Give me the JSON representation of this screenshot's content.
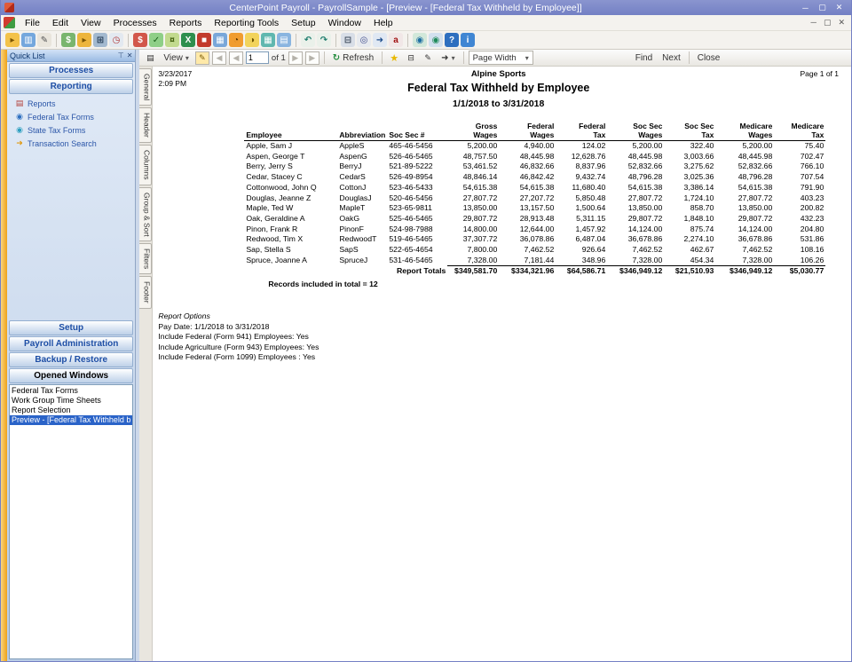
{
  "window": {
    "title": "CenterPoint Payroll - PayrollSample - [Preview - [Federal Tax Withheld by Employee]]",
    "controls": {
      "minimize": "─",
      "restore": "▢",
      "close": "✕"
    }
  },
  "menu": {
    "items": [
      "File",
      "Edit",
      "View",
      "Processes",
      "Reports",
      "Reporting Tools",
      "Setup",
      "Window",
      "Help"
    ]
  },
  "toolbar": {
    "icons": [
      {
        "name": "open-icon",
        "glyph": "▸",
        "bg": "#f3c24a",
        "color": "#7a5403"
      },
      {
        "name": "new-window-icon",
        "glyph": "▥",
        "bg": "#74a7dd",
        "color": "#ffffff"
      },
      {
        "name": "edit-icon",
        "glyph": "✎",
        "bg": "#e9e5dc",
        "color": "#555555"
      },
      {
        "sep": true
      },
      {
        "name": "money-icon",
        "glyph": "$",
        "bg": "#79b56e",
        "color": "#ffffff"
      },
      {
        "name": "folder-icon",
        "glyph": "▸",
        "bg": "#edb53c",
        "color": "#7a5403"
      },
      {
        "name": "calculator-icon",
        "glyph": "⊞",
        "bg": "#a3b9cf",
        "color": "#243b55"
      },
      {
        "name": "time-clock-icon",
        "glyph": "◷",
        "bg": "#e3e9f0",
        "color": "#b03434"
      },
      {
        "sep": true
      },
      {
        "name": "pay-employees-icon",
        "glyph": "$",
        "bg": "#d2574a",
        "color": "#ffffff"
      },
      {
        "name": "pay-checks-icon",
        "glyph": "✓",
        "bg": "#8fcf87",
        "color": "#175e17"
      },
      {
        "name": "cash-icon",
        "glyph": "¤",
        "bg": "#c2da8e",
        "color": "#42600f"
      },
      {
        "name": "excel-export-icon",
        "glyph": "X",
        "bg": "#2e8f4d",
        "color": "#ffffff"
      },
      {
        "name": "stop-icon",
        "glyph": "■",
        "bg": "#c23a2b",
        "color": "#ffffff"
      },
      {
        "name": "table-icon",
        "glyph": "▦",
        "bg": "#79a7d9",
        "color": "#ffffff"
      },
      {
        "name": "alarm-clock-icon",
        "glyph": "◔",
        "bg": "#f09c2f",
        "color": "#5d3800"
      },
      {
        "name": "timesheet-icon",
        "glyph": "◑",
        "bg": "#f2d35b",
        "color": "#6b5200"
      },
      {
        "name": "calendar-icon",
        "glyph": "▦",
        "bg": "#5fb7af",
        "color": "#ffffff"
      },
      {
        "name": "grid-icon",
        "glyph": "▤",
        "bg": "#8ab5e0",
        "color": "#ffffff"
      },
      {
        "sep": true
      },
      {
        "name": "undo-icon",
        "glyph": "↶",
        "bg": "#eaf1ea",
        "color": "#1e7c6d"
      },
      {
        "name": "redo-icon",
        "glyph": "↷",
        "bg": "#eaf1ea",
        "color": "#1e7c6d"
      },
      {
        "sep": true
      },
      {
        "name": "print-icon",
        "glyph": "⊟",
        "bg": "#d8dee7",
        "color": "#3d4a5c"
      },
      {
        "name": "print-preview-icon",
        "glyph": "◎",
        "bg": "#e7eaef",
        "color": "#3d4a8c"
      },
      {
        "name": "export-icon",
        "glyph": "➜",
        "bg": "#e0e8f3",
        "color": "#1f4e8c"
      },
      {
        "name": "pdf-icon",
        "glyph": "a",
        "bg": "#f1e7e7",
        "color": "#a01010"
      },
      {
        "sep": true
      },
      {
        "name": "globe-icon",
        "glyph": "◉",
        "bg": "#d2e8da",
        "color": "#1d6fa1"
      },
      {
        "name": "web-icon",
        "glyph": "◉",
        "bg": "#d2e0ee",
        "color": "#1e8a59"
      },
      {
        "name": "help-icon",
        "glyph": "?",
        "bg": "#2e6fbf",
        "color": "#ffffff"
      },
      {
        "name": "about-icon",
        "glyph": "i",
        "bg": "#4086d3",
        "color": "#ffffff"
      }
    ]
  },
  "quick_list": {
    "title": "Quick List",
    "header_icons": {
      "pin": "⊤",
      "close": "✕"
    },
    "processes_label": "Processes",
    "reporting_label": "Reporting",
    "reporting_items": [
      {
        "label": "Reports",
        "icon": "reports-icon",
        "glyph": "▤",
        "color": "#b2403a"
      },
      {
        "label": "Federal Tax Forms",
        "icon": "federal-tax-forms-icon",
        "glyph": "◉",
        "color": "#2d6fc0"
      },
      {
        "label": "State Tax Forms",
        "icon": "state-tax-forms-icon",
        "glyph": "◉",
        "color": "#2d9fc0"
      },
      {
        "label": "Transaction Search",
        "icon": "transaction-search-icon",
        "glyph": "➜",
        "color": "#e09a12"
      }
    ],
    "setup_label": "Setup",
    "payroll_admin_label": "Payroll Administration",
    "backup_label": "Backup / Restore",
    "opened_windows_label": "Opened Windows",
    "opened_windows": {
      "items": [
        "Federal Tax Forms",
        "Work Group Time Sheets",
        "Report Selection",
        "Preview - [Federal Tax Withheld b"
      ],
      "selected_index": 3
    }
  },
  "preview": {
    "toolbar": {
      "options_icon": "▤",
      "view_label": "View",
      "caret": "▾",
      "annotation_icon": "✎",
      "nav_first": "◀",
      "nav_prev": "◀",
      "page_value": "1",
      "pages_label": "of 1",
      "nav_next": "▶",
      "nav_last": "▶",
      "refresh_icon": "↻",
      "refresh_label": "Refresh",
      "favorite_icon": "★",
      "print_icon": "⊟",
      "page_setup_icon": "✎",
      "export_icon": "➜",
      "zoom_value": "Page Width",
      "find_label": "Find",
      "next_label": "Next",
      "close_label": "Close"
    },
    "side_tabs": [
      "General",
      "Header",
      "Columns",
      "Group & Sort",
      "Filters",
      "Footer"
    ]
  },
  "report": {
    "generated_date": "3/23/2017",
    "generated_time": "2:09 PM",
    "company": "Alpine Sports",
    "title": "Federal Tax Withheld by Employee",
    "date_range": "1/1/2018 to 3/31/2018",
    "page_label": "Page 1 of 1",
    "table": {
      "columns": [
        {
          "label": "Employee"
        },
        {
          "label": "Abbreviation"
        },
        {
          "label": "Soc Sec #"
        },
        {
          "label": "Gross\nWages"
        },
        {
          "label": "Federal\nWages"
        },
        {
          "label": "Federal\nTax"
        },
        {
          "label": "Soc Sec\nWages"
        },
        {
          "label": "Soc Sec\nTax"
        },
        {
          "label": "Medicare\nWages"
        },
        {
          "label": "Medicare\nTax"
        }
      ],
      "rows": [
        [
          "Apple, Sam J",
          "AppleS",
          "465-46-5456",
          "5,200.00",
          "4,940.00",
          "124.02",
          "5,200.00",
          "322.40",
          "5,200.00",
          "75.40"
        ],
        [
          "Aspen, George T",
          "AspenG",
          "526-46-5465",
          "48,757.50",
          "48,445.98",
          "12,628.76",
          "48,445.98",
          "3,003.66",
          "48,445.98",
          "702.47"
        ],
        [
          "Berry, Jerry S",
          "BerryJ",
          "521-89-5222",
          "53,461.52",
          "46,832.66",
          "8,837.96",
          "52,832.66",
          "3,275.62",
          "52,832.66",
          "766.10"
        ],
        [
          "Cedar, Stacey C",
          "CedarS",
          "526-49-8954",
          "48,846.14",
          "46,842.42",
          "9,432.74",
          "48,796.28",
          "3,025.36",
          "48,796.28",
          "707.54"
        ],
        [
          "Cottonwood, John Q",
          "CottonJ",
          "523-46-5433",
          "54,615.38",
          "54,615.38",
          "11,680.40",
          "54,615.38",
          "3,386.14",
          "54,615.38",
          "791.90"
        ],
        [
          "Douglas, Jeanne Z",
          "DouglasJ",
          "520-46-5456",
          "27,807.72",
          "27,207.72",
          "5,850.48",
          "27,807.72",
          "1,724.10",
          "27,807.72",
          "403.23"
        ],
        [
          "Maple, Ted W",
          "MapleT",
          "523-65-9811",
          "13,850.00",
          "13,157.50",
          "1,500.64",
          "13,850.00",
          "858.70",
          "13,850.00",
          "200.82"
        ],
        [
          "Oak, Geraldine A",
          "OakG",
          "525-46-5465",
          "29,807.72",
          "28,913.48",
          "5,311.15",
          "29,807.72",
          "1,848.10",
          "29,807.72",
          "432.23"
        ],
        [
          "Pinon, Frank R",
          "PinonF",
          "524-98-7988",
          "14,800.00",
          "12,644.00",
          "1,457.92",
          "14,124.00",
          "875.74",
          "14,124.00",
          "204.80"
        ],
        [
          "Redwood, Tim X",
          "RedwoodT",
          "519-46-5465",
          "37,307.72",
          "36,078.86",
          "6,487.04",
          "36,678.86",
          "2,274.10",
          "36,678.86",
          "531.86"
        ],
        [
          "Sap, Stella S",
          "SapS",
          "522-65-4654",
          "7,800.00",
          "7,462.52",
          "926.64",
          "7,462.52",
          "462.67",
          "7,462.52",
          "108.16"
        ],
        [
          "Spruce, Joanne A",
          "SpruceJ",
          "531-46-5465",
          "7,328.00",
          "7,181.44",
          "348.96",
          "7,328.00",
          "454.34",
          "7,328.00",
          "106.26"
        ]
      ],
      "totals_label": "Report Totals",
      "totals": [
        "$349,581.70",
        "$334,321.96",
        "$64,586.71",
        "$346,949.12",
        "$21,510.93",
        "$346,949.12",
        "$5,030.77"
      ]
    },
    "records_note": "Records included in total = 12",
    "options_title": "Report Options",
    "options": [
      "Pay Date: 1/1/2018 to 3/31/2018",
      "Include Federal (Form 941) Employees: Yes",
      "Include Agriculture (Form 943) Employees: Yes",
      "Include Federal (Form 1099) Employees : Yes"
    ]
  }
}
